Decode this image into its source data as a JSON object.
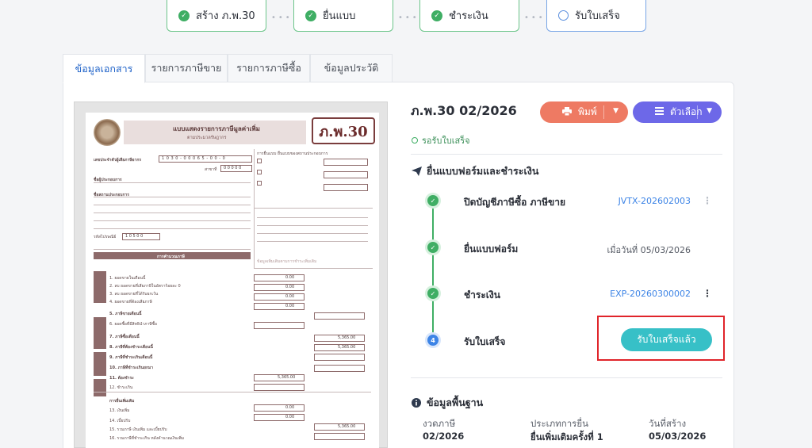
{
  "stepper": [
    {
      "label": "สร้าง ภ.พ.30",
      "state": "done"
    },
    {
      "label": "ยื่นแบบ",
      "state": "done"
    },
    {
      "label": "ชำระเงิน",
      "state": "done"
    },
    {
      "label": "รับใบเสร็จ",
      "state": "current"
    }
  ],
  "tabs": [
    "ข้อมูลเอกสาร",
    "รายการภาษีขาย",
    "รายการภาษีซื้อ",
    "ข้อมูลประวัติ"
  ],
  "form_preview": {
    "form_code": "ภ.พ.30",
    "header_title": "แบบแสดงรายการภาษีมูลค่าเพิ่ม",
    "header_subtitle": "ตามประมวลรัษฎากร",
    "tax_id": "1 0 3 0 - 0 0 0 6 5 - 0 0 - 0",
    "branch": "0 0 0 0 0",
    "postal_code": "1 0 5 0 0",
    "section_label": "การคำนวณภาษี",
    "amounts": [
      "0.00",
      "0.00",
      "0.00",
      "0.00",
      "5,365.00",
      "5,365.00",
      "5,365.00",
      "0.00",
      "0.00",
      "5,365.00"
    ],
    "footer_label": "ข้อมูลเพิ่มเติมตามการชำระเพิ่มเติม"
  },
  "document": {
    "title": "ภ.พ.30 02/2026",
    "status": "รอรับใบเสร็จ"
  },
  "actions": {
    "print_label": "พิมพ์",
    "options_label": "ตัวเลือก"
  },
  "filing_section": {
    "title": "ยื่นแบบฟอร์มและชำระเงิน",
    "steps": [
      {
        "number": "✓",
        "label": "ปิดบัญชีภาษีซื้อ ภาษีขาย",
        "value": "JVTX-202602003"
      },
      {
        "number": "✓",
        "label": "ยื่นแบบฟอร์ม",
        "value": "เมื่อวันที่ 05/03/2026"
      },
      {
        "number": "✓",
        "label": "ชำระเงิน",
        "value": "EXP-20260300002"
      },
      {
        "number": "4",
        "label": "รับใบเสร็จ",
        "button": "รับใบเสร็จแล้ว"
      }
    ]
  },
  "basic_info": {
    "title": "ข้อมูลพื้นฐาน",
    "fields": [
      {
        "label": "งวดภาษี",
        "value": "02/2026"
      },
      {
        "label": "ประเภทการยื่น",
        "value": "ยื่นเพิ่มเติมครั้งที่ 1"
      },
      {
        "label": "วันที่สร้าง",
        "value": "05/03/2026"
      }
    ]
  },
  "colors": {
    "print": "#ee7a63",
    "options": "#6d68e8",
    "receive": "#37c0c7",
    "done": "#3fae64",
    "highlight": "#e0242a"
  }
}
